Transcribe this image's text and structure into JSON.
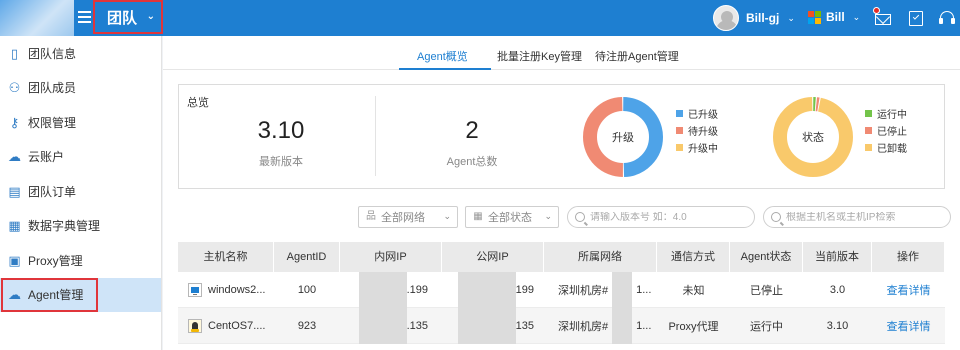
{
  "header": {
    "team_label": "团队",
    "user_name": "Bill-gj",
    "org_name": "Bill",
    "brand_colors": [
      "#f25022",
      "#7fba00",
      "#00a4ef",
      "#ffb900"
    ],
    "icons": [
      "menu-icon",
      "mail-icon",
      "clipboard-icon",
      "headset-icon"
    ]
  },
  "sidebar": {
    "items": [
      {
        "label": "团队信息",
        "icon": "team-info-icon",
        "glyph": "▯"
      },
      {
        "label": "团队成员",
        "icon": "team-members-icon",
        "glyph": "⚇"
      },
      {
        "label": "权限管理",
        "icon": "permission-icon",
        "glyph": "⚷"
      },
      {
        "label": "云账户",
        "icon": "cloud-icon",
        "glyph": "☁"
      },
      {
        "label": "团队订单",
        "icon": "order-icon",
        "glyph": "▤"
      },
      {
        "label": "数据字典管理",
        "icon": "dictionary-icon",
        "glyph": "▦"
      },
      {
        "label": "Proxy管理",
        "icon": "proxy-icon",
        "glyph": "▣"
      },
      {
        "label": "Agent管理",
        "icon": "agent-icon",
        "glyph": "☁"
      }
    ],
    "active_index": 7
  },
  "tabs": [
    {
      "label": "Agent概览"
    },
    {
      "label": "批量注册Key管理"
    },
    {
      "label": "待注册Agent管理"
    }
  ],
  "overview": {
    "title": "总览",
    "latest_version": {
      "value": "3.10",
      "label": "最新版本"
    },
    "agent_total": {
      "value": "2",
      "label": "Agent总数"
    },
    "upgrade_chart": {
      "center_label": "升级",
      "legend": [
        {
          "label": "已升级",
          "color": "#4ea3e8",
          "fraction": 0.5
        },
        {
          "label": "待升级",
          "color": "#f08a73",
          "fraction": 0.5
        },
        {
          "label": "升级中",
          "color": "#f9c96b",
          "fraction": 0
        }
      ]
    },
    "status_chart": {
      "center_label": "状态",
      "legend": [
        {
          "label": "运行中",
          "color": "#73c44a",
          "fraction": 0.015
        },
        {
          "label": "已停止",
          "color": "#f08a73",
          "fraction": 0.015
        },
        {
          "label": "已卸载",
          "color": "#f9c96b",
          "fraction": 0.97
        }
      ]
    }
  },
  "filters": {
    "network": "全部网络",
    "status": "全部状态",
    "version_search_placeholder": "请输入版本号 如：4.0",
    "host_search_placeholder": "根据主机名或主机IP检索"
  },
  "table": {
    "columns": [
      "主机名称",
      "AgentID",
      "内网IP",
      "公网IP",
      "所属网络",
      "通信方式",
      "Agent状态",
      "当前版本",
      "操作"
    ],
    "rows": [
      {
        "os": "windows",
        "host": "windows2...",
        "agent_id": "100",
        "inner_ip": ".199",
        "public_ip": "199",
        "network": "深圳机房#",
        "network_suffix": "1...",
        "comm": "未知",
        "status": "已停止",
        "version": "3.0",
        "action": "查看详情"
      },
      {
        "os": "linux",
        "host": "CentOS7....",
        "agent_id": "923",
        "inner_ip": ".135",
        "public_ip": "135",
        "network": "深圳机房#",
        "network_suffix": "1...",
        "comm": "Proxy代理",
        "status": "运行中",
        "version": "3.10",
        "action": "查看详情"
      }
    ]
  }
}
